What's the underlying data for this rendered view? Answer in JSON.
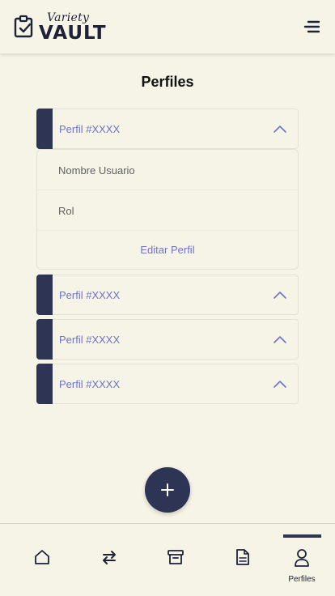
{
  "header": {
    "logo_small": "Variety",
    "logo_big": "VAULT"
  },
  "page": {
    "title": "Perfiles"
  },
  "profiles": [
    {
      "label": "Perfil #XXXX",
      "expanded": true
    },
    {
      "label": "Perfil #XXXX",
      "expanded": false
    },
    {
      "label": "Perfil #XXXX",
      "expanded": false
    },
    {
      "label": "Perfil #XXXX",
      "expanded": false
    }
  ],
  "detail": {
    "username": "Nombre Usuario",
    "role": "Rol",
    "edit_label": "Editar Perfil"
  },
  "nav": {
    "items": [
      {
        "icon": "home-icon"
      },
      {
        "icon": "transfer-icon"
      },
      {
        "icon": "archive-icon"
      },
      {
        "icon": "document-icon"
      },
      {
        "icon": "user-icon",
        "label": "Perfiles",
        "active": true
      }
    ]
  },
  "colors": {
    "primary": "#2e3454",
    "accent": "#6f74c6",
    "background": "#f6f4e6"
  }
}
